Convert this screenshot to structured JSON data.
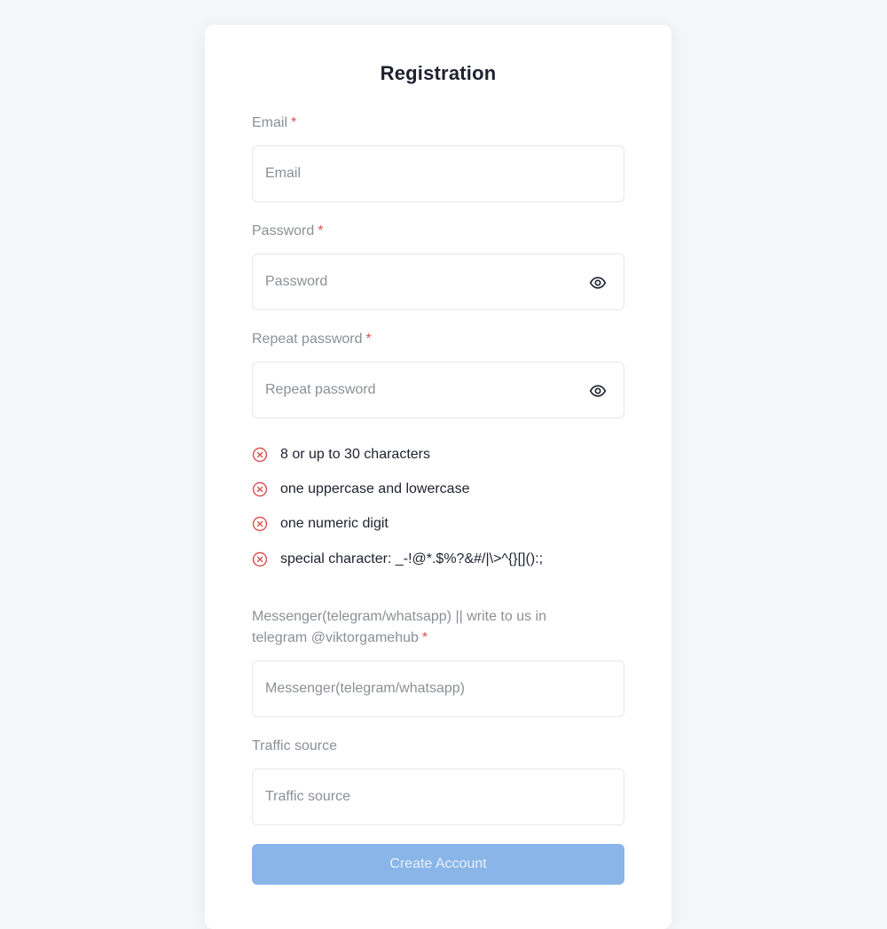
{
  "form": {
    "title": "Registration",
    "required_mark": "*",
    "email": {
      "label": "Email",
      "placeholder": "Email",
      "value": ""
    },
    "password": {
      "label": "Password",
      "placeholder": "Password",
      "value": "",
      "toggle_icon": "eye-icon"
    },
    "repeat_password": {
      "label": "Repeat password",
      "placeholder": "Repeat password",
      "value": "",
      "toggle_icon": "eye-icon"
    },
    "password_rules": [
      {
        "text": "8 or up to 30 characters",
        "status": "invalid",
        "icon": "x-circle-icon"
      },
      {
        "text": "one uppercase and lowercase",
        "status": "invalid",
        "icon": "x-circle-icon"
      },
      {
        "text": "one numeric digit",
        "status": "invalid",
        "icon": "x-circle-icon"
      },
      {
        "text": "special character: _-!@*.$%?&#/|\\>^{}[]():;",
        "status": "invalid",
        "icon": "x-circle-icon"
      }
    ],
    "messenger": {
      "label_line1": "Messenger(telegram/whatsapp) || write to us in",
      "label_line2": "telegram @viktorgamehub",
      "placeholder": "Messenger(telegram/whatsapp)",
      "value": ""
    },
    "traffic_source": {
      "label": "Traffic source",
      "placeholder": "Traffic source",
      "value": ""
    },
    "submit_label": "Create Account"
  },
  "colors": {
    "error": "#d9534f",
    "button_bg": "#89b5e8",
    "title": "#1f2130",
    "label": "#8c8f96"
  }
}
